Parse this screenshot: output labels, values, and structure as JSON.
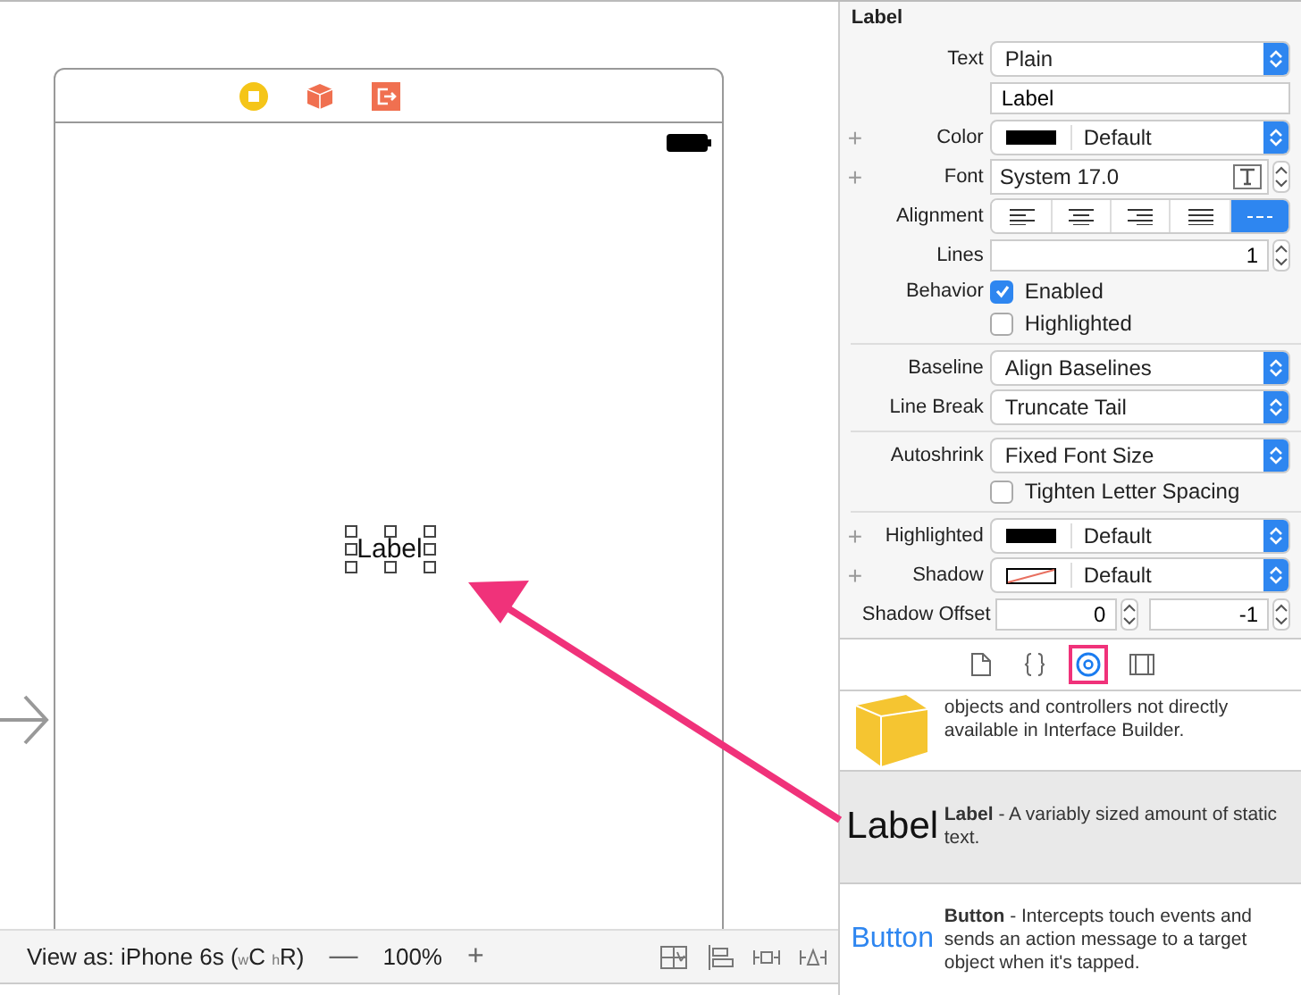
{
  "canvas": {
    "scene_dock": [
      {
        "kind": "view-controller"
      },
      {
        "kind": "first-responder"
      },
      {
        "kind": "exit"
      }
    ],
    "label": "Label",
    "bottom_bar": {
      "view_as": "View as: iPhone 6s ($_{w}$C $_{h}$R)",
      "zoom_out": "—",
      "zoom": "100%",
      "zoom_in": "+",
      "tools": [
        {
          "kind": "embed"
        },
        {
          "kind": "align"
        },
        {
          "kind": "pin"
        },
        {
          "kind": "resolve"
        }
      ]
    }
  },
  "inspector": {
    "title": "Label",
    "rows": [
      {
        "kind": "popup",
        "label": "Text",
        "value": "Plain"
      },
      {
        "kind": "field",
        "value": "Label"
      },
      {
        "kind": "color",
        "label": "Color",
        "value": "Default",
        "color": "#000000",
        "plus": "+"
      },
      {
        "kind": "font",
        "label": "Font",
        "value": "System 17.0",
        "plus": "+"
      },
      {
        "kind": "alignment",
        "label": "Alignment",
        "options": [
          {
            "kind": "left",
            "selected": false
          },
          {
            "kind": "center",
            "selected": false
          },
          {
            "kind": "right",
            "selected": false
          },
          {
            "kind": "justified",
            "selected": false
          },
          {
            "kind": "natural",
            "selected": true
          }
        ]
      },
      {
        "kind": "stepper",
        "label": "Lines",
        "value": "1"
      },
      {
        "kind": "checkbox",
        "label": "Behavior",
        "text": "Enabled",
        "checked": true
      },
      {
        "kind": "checkbox",
        "text": "Highlighted",
        "checked": false
      },
      {
        "kind": "divider"
      },
      {
        "kind": "popup",
        "label": "Baseline",
        "value": "Align Baselines"
      },
      {
        "kind": "popup",
        "label": "Line Break",
        "value": "Truncate Tail"
      },
      {
        "kind": "divider"
      },
      {
        "kind": "popup",
        "label": "Autoshrink",
        "value": "Fixed Font Size"
      },
      {
        "kind": "checkbox",
        "text": "Tighten Letter Spacing",
        "checked": false
      },
      {
        "kind": "divider"
      },
      {
        "kind": "color",
        "label": "Highlighted",
        "value": "Default",
        "color": "#000000",
        "plus": "+"
      },
      {
        "kind": "no-color",
        "label": "Shadow",
        "value": "Default",
        "plus": "+"
      },
      {
        "kind": "offset",
        "label": "Shadow Offset",
        "values": [
          "0",
          "-1"
        ]
      }
    ]
  },
  "library_tabs": [
    {
      "kind": "file",
      "selected": false
    },
    {
      "kind": "braces",
      "selected": false
    },
    {
      "kind": "object",
      "selected": true
    },
    {
      "kind": "media",
      "selected": false
    }
  ],
  "library": [
    {
      "kind": "object",
      "description": "objects and controllers not directly available in Interface Builder.",
      "selected": false
    },
    {
      "kind": "label",
      "preview": "Label",
      "description": "**Label** - A variably sized amount of static text.",
      "selected": true
    },
    {
      "kind": "button",
      "preview": "Button",
      "description": "**Button** - Intercepts touch events and sends an action message to a target object when it's tapped.",
      "selected": false
    }
  ]
}
